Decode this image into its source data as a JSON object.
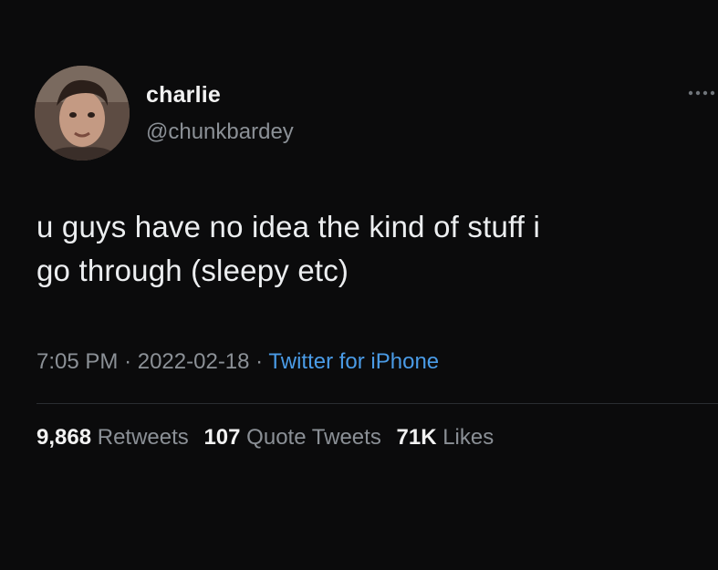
{
  "user": {
    "name": "charlie",
    "handle": "@chunkbardey"
  },
  "tweet": {
    "text_line1": "u guys have no idea the kind of stuff i",
    "text_line2": "go through (sleepy etc)",
    "time": "7:05 PM",
    "separator": "·",
    "date": "2022-02-18",
    "source": "Twitter for iPhone"
  },
  "stats": {
    "retweets_count": "9,868",
    "retweets_label": "Retweets",
    "quotes_count": "107",
    "quotes_label": "Quote Tweets",
    "likes_count": "71K",
    "likes_label": "Likes"
  },
  "icons": {
    "more": "more-horizontal-icon"
  },
  "colors": {
    "background": "#0b0b0c",
    "text": "#e7e9ea",
    "muted": "#8b9096",
    "link": "#4a9be6"
  }
}
